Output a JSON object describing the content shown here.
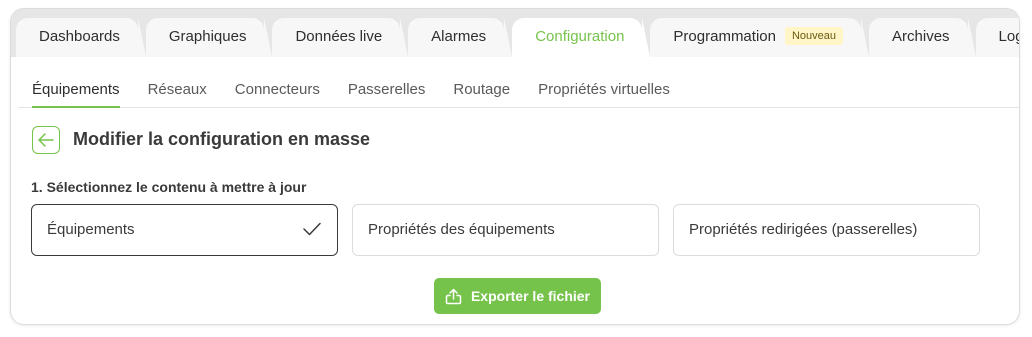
{
  "top_tabs": [
    {
      "label": "Dashboards",
      "active": false
    },
    {
      "label": "Graphiques",
      "active": false
    },
    {
      "label": "Données live",
      "active": false
    },
    {
      "label": "Alarmes",
      "active": false
    },
    {
      "label": "Configuration",
      "active": true
    },
    {
      "label": "Programmation",
      "badge": "Nouveau",
      "active": false
    },
    {
      "label": "Archives",
      "active": false
    },
    {
      "label": "Logs",
      "active": false
    }
  ],
  "sub_tabs": [
    {
      "label": "Équipements",
      "active": true
    },
    {
      "label": "Réseaux",
      "active": false
    },
    {
      "label": "Connecteurs",
      "active": false
    },
    {
      "label": "Passerelles",
      "active": false
    },
    {
      "label": "Routage",
      "active": false
    },
    {
      "label": "Propriétés virtuelles",
      "active": false
    }
  ],
  "header": {
    "back_icon": "arrow-left-icon",
    "title": "Modifier la configuration en masse"
  },
  "step": {
    "label": "1. Sélectionnez le contenu à mettre à jour",
    "options": [
      {
        "label": "Équipements",
        "selected": true
      },
      {
        "label": "Propriétés des équipements",
        "selected": false
      },
      {
        "label": "Propriétés redirigées (passerelles)",
        "selected": false
      }
    ]
  },
  "export": {
    "label": "Exporter le fichier",
    "icon": "upload-icon"
  },
  "colors": {
    "accent": "#76c34b",
    "tabbar": "#e6e6e6",
    "badge_bg": "#fff5c7"
  }
}
